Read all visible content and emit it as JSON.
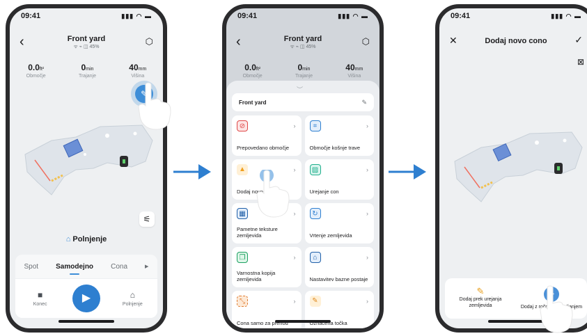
{
  "status_time": "09:41",
  "phone1": {
    "title": "Front yard",
    "subtitle": "ᯤ  ⌁  ◫  45%",
    "stats": [
      {
        "value": "0.0",
        "unit": "ft²",
        "label": "Območje"
      },
      {
        "value": "0",
        "unit": "min",
        "label": "Trajanje"
      },
      {
        "value": "40",
        "unit": "mm",
        "label": "Višina"
      }
    ],
    "status_label": "Polnjenje",
    "modes": [
      "Spot",
      "Samodejno",
      "Cona"
    ],
    "active_mode": "Samodejno",
    "controls": {
      "stop": "Konec",
      "dock": "Polnjenje"
    }
  },
  "phone2": {
    "title": "Front yard",
    "subtitle": "ᯤ  ⌁  ◫  45%",
    "stats": [
      {
        "value": "0.0",
        "unit": "ft²",
        "label": "Območje"
      },
      {
        "value": "0",
        "unit": "min",
        "label": "Trajanje"
      },
      {
        "value": "40",
        "unit": "mm",
        "label": "Višina"
      }
    ],
    "map_name": "Front yard",
    "menu": [
      {
        "label": "Prepovedano območje",
        "icon": "no-go-zone-icon",
        "glyph": "⊘",
        "cls": "ic-red"
      },
      {
        "label": "Območje košnje trave",
        "icon": "mowing-zone-icon",
        "glyph": "⌗",
        "cls": "ic-blue"
      },
      {
        "label": "Dodaj novo cono",
        "icon": "add-zone-icon",
        "glyph": "▲",
        "cls": "ic-orange"
      },
      {
        "label": "Urejanje con",
        "icon": "edit-zones-icon",
        "glyph": "▨",
        "cls": "ic-teal"
      },
      {
        "label": "Pametne teksture zemljevida",
        "icon": "smart-texture-icon",
        "glyph": "▦",
        "cls": "ic-navy"
      },
      {
        "label": "Vrtenje zemljevida",
        "icon": "rotate-map-icon",
        "glyph": "↻",
        "cls": "ic-blue"
      },
      {
        "label": "Varnostna kopija zemljevida",
        "icon": "map-backup-icon",
        "glyph": "❐",
        "cls": "ic-green"
      },
      {
        "label": "Nastavitev bazne postaje",
        "icon": "base-station-icon",
        "glyph": "⌂",
        "cls": "ic-navy"
      },
      {
        "label": "Cona samo za prehod",
        "icon": "passage-zone-icon",
        "glyph": "⤡",
        "cls": "ic-hatch"
      },
      {
        "label": "Označena točka",
        "icon": "marked-point-icon",
        "glyph": "✎",
        "cls": "ic-tool"
      }
    ]
  },
  "phone3": {
    "title": "Dodaj novo cono",
    "options": [
      {
        "label": "Dodaj prek urejanja zemljevida"
      },
      {
        "label": "Dodaj z ročnim upravljanjem"
      }
    ]
  },
  "colors": {
    "accent": "#2e7fd0",
    "arrow": "#2e7fd0"
  }
}
